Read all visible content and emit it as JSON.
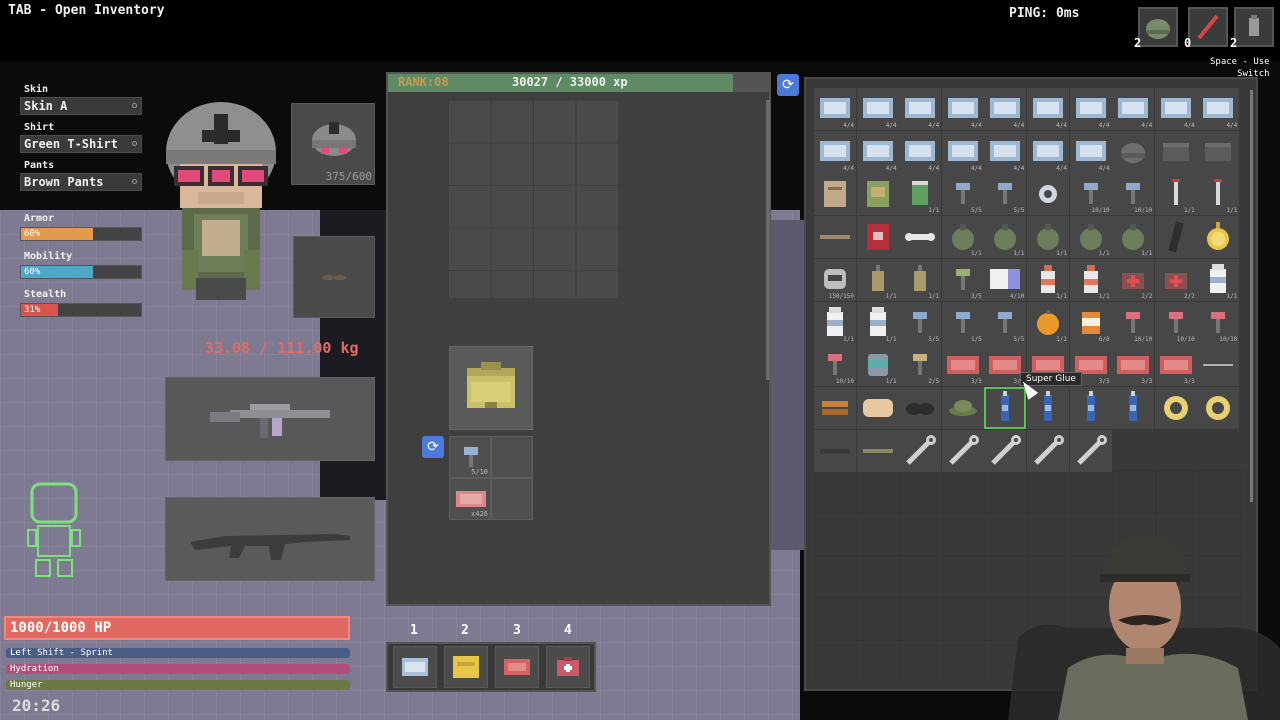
{
  "hud": {
    "hint": "TAB - Open Inventory",
    "ping": "PING: 0ms",
    "quick_counts": [
      "2",
      "0",
      "2"
    ],
    "key_hint_line1": "Space - Use",
    "key_hint_line2": "Switch"
  },
  "outfit": {
    "skin_label": "Skin",
    "skin_value": "Skin A",
    "shirt_label": "Shirt",
    "shirt_value": "Green T-Shirt",
    "pants_label": "Pants",
    "pants_value": "Brown Pants"
  },
  "stats": {
    "armor_label": "Armor",
    "armor_pct": "60%",
    "armor_value": 0.6,
    "mobility_label": "Mobility",
    "mobility_pct": "60%",
    "mobility_value": 0.6,
    "stealth_label": "Stealth",
    "stealth_pct": "31%",
    "stealth_value": 0.31,
    "armor_color": "#e39a4f",
    "mobility_color": "#4fa6c8",
    "stealth_color": "#d9534f"
  },
  "equipment": {
    "helmet_durability": "375/600",
    "weight": "33.08 / 111.00 kg"
  },
  "vitals": {
    "hp": "1000/1000 HP",
    "sprint": "Left Shift - Sprint",
    "hydration": "Hydration",
    "hunger": "Hunger",
    "clock": "20:26"
  },
  "rank": {
    "label": "RANK:08",
    "xp": "30027 / 33000 xp",
    "progress": 0.91
  },
  "pockets": [
    {
      "qty": "5/10"
    },
    {
      "qty": "x426"
    }
  ],
  "hotbar": {
    "numbers": [
      "1",
      "2",
      "3",
      "4"
    ]
  },
  "stash": {
    "tooltip": "Super Glue",
    "rows": [
      [
        {
          "icon": "ammo-box",
          "q": "4/4"
        },
        {
          "icon": "ammo-box",
          "q": "4/4"
        },
        {
          "icon": "ammo-box",
          "q": "4/4"
        },
        {
          "icon": "ammo-box",
          "q": "4/4"
        },
        {
          "icon": "ammo-box",
          "q": "4/4"
        },
        {
          "icon": "ammo-box",
          "q": "4/4"
        },
        {
          "icon": "ammo-box",
          "q": "4/4"
        },
        {
          "icon": "ammo-box",
          "q": "4/4"
        },
        {
          "icon": "ammo-box",
          "q": "4/4"
        },
        {
          "icon": "ammo-box",
          "q": "4/4"
        }
      ],
      [
        {
          "icon": "ammo-box",
          "q": "4/4"
        },
        {
          "icon": "ammo-box",
          "q": "4/4"
        },
        {
          "icon": "ammo-box",
          "q": "4/4"
        },
        {
          "icon": "ammo-box",
          "q": "4/4"
        },
        {
          "icon": "ammo-box",
          "q": "4/4"
        },
        {
          "icon": "ammo-box",
          "q": "4/4"
        },
        {
          "icon": "ammo-box",
          "q": "4/4"
        },
        {
          "icon": "helmet",
          "q": ""
        },
        {
          "icon": "crate",
          "q": ""
        },
        {
          "icon": "crate",
          "q": ""
        }
      ],
      [
        {
          "icon": "book",
          "q": ""
        },
        {
          "icon": "book-green",
          "q": ""
        },
        {
          "icon": "can",
          "q": "1/1"
        },
        {
          "icon": "hammer",
          "q": "5/5"
        },
        {
          "icon": "hammer",
          "q": "5/5"
        },
        {
          "icon": "tape",
          "q": ""
        },
        {
          "icon": "hammer",
          "q": "10/10"
        },
        {
          "icon": "hammer",
          "q": "10/10"
        },
        {
          "icon": "syringe",
          "q": "1/1"
        },
        {
          "icon": "syringe",
          "q": "1/1"
        }
      ],
      [
        {
          "icon": "stick",
          "q": ""
        },
        {
          "icon": "book-red",
          "q": ""
        },
        {
          "icon": "bone",
          "q": ""
        },
        {
          "icon": "grenade",
          "q": "1/1"
        },
        {
          "icon": "grenade",
          "q": "1/1"
        },
        {
          "icon": "grenade",
          "q": "1/1"
        },
        {
          "icon": "grenade",
          "q": "1/1"
        },
        {
          "icon": "grenade",
          "q": "1/1"
        },
        {
          "icon": "magazine",
          "q": ""
        },
        {
          "icon": "watch",
          "q": ""
        }
      ],
      [
        {
          "icon": "mask",
          "q": "150/150"
        },
        {
          "icon": "lantern",
          "q": "1/1"
        },
        {
          "icon": "lantern",
          "q": "1/1"
        },
        {
          "icon": "hammer-green",
          "q": "3/5"
        },
        {
          "icon": "cloth",
          "q": "4/10"
        },
        {
          "icon": "bottle",
          "q": "1/1"
        },
        {
          "icon": "bottle",
          "q": "1/1"
        },
        {
          "icon": "medkit",
          "q": "2/2"
        },
        {
          "icon": "medkit",
          "q": "2/2"
        },
        {
          "icon": "milk",
          "q": "1/1"
        }
      ],
      [
        {
          "icon": "milk",
          "q": "1/1"
        },
        {
          "icon": "milk",
          "q": "1/1"
        },
        {
          "icon": "hammer",
          "q": "5/5"
        },
        {
          "icon": "hammer",
          "q": "1/5"
        },
        {
          "icon": "hammer",
          "q": "5/5"
        },
        {
          "icon": "orange",
          "q": "1/1"
        },
        {
          "icon": "pills",
          "q": "6/8"
        },
        {
          "icon": "hammer-red",
          "q": "10/10"
        },
        {
          "icon": "hammer-red",
          "q": "10/10"
        },
        {
          "icon": "hammer-red",
          "q": "10/10"
        }
      ],
      [
        {
          "icon": "hammer-red",
          "q": "10/10"
        },
        {
          "icon": "jar",
          "q": "1/1"
        },
        {
          "icon": "hammer-tan",
          "q": "2/5"
        },
        {
          "icon": "wallet",
          "q": "3/3"
        },
        {
          "icon": "wallet",
          "q": "3/3"
        },
        {
          "icon": "wallet",
          "q": "3/3"
        },
        {
          "icon": "wallet",
          "q": "3/3"
        },
        {
          "icon": "wallet",
          "q": "3/3"
        },
        {
          "icon": "wallet",
          "q": "3/3"
        },
        {
          "icon": "pin",
          "q": ""
        }
      ],
      [
        {
          "icon": "wood",
          "q": ""
        },
        {
          "icon": "bread",
          "q": ""
        },
        {
          "icon": "goggles",
          "q": ""
        },
        {
          "icon": "hat",
          "q": ""
        },
        {
          "icon": "glue",
          "q": "",
          "sel": true
        },
        {
          "icon": "glue",
          "q": ""
        },
        {
          "icon": "glue",
          "q": ""
        },
        {
          "icon": "glue",
          "q": ""
        },
        {
          "icon": "tape-roll",
          "q": ""
        },
        {
          "icon": "tape-roll",
          "q": ""
        }
      ],
      [
        {
          "icon": "knife",
          "q": ""
        },
        {
          "icon": "pipe",
          "q": ""
        },
        {
          "icon": "wrench",
          "q": ""
        },
        {
          "icon": "wrench",
          "q": ""
        },
        {
          "icon": "wrench",
          "q": ""
        },
        {
          "icon": "wrench",
          "q": ""
        },
        {
          "icon": "wrench",
          "q": ""
        }
      ]
    ]
  }
}
